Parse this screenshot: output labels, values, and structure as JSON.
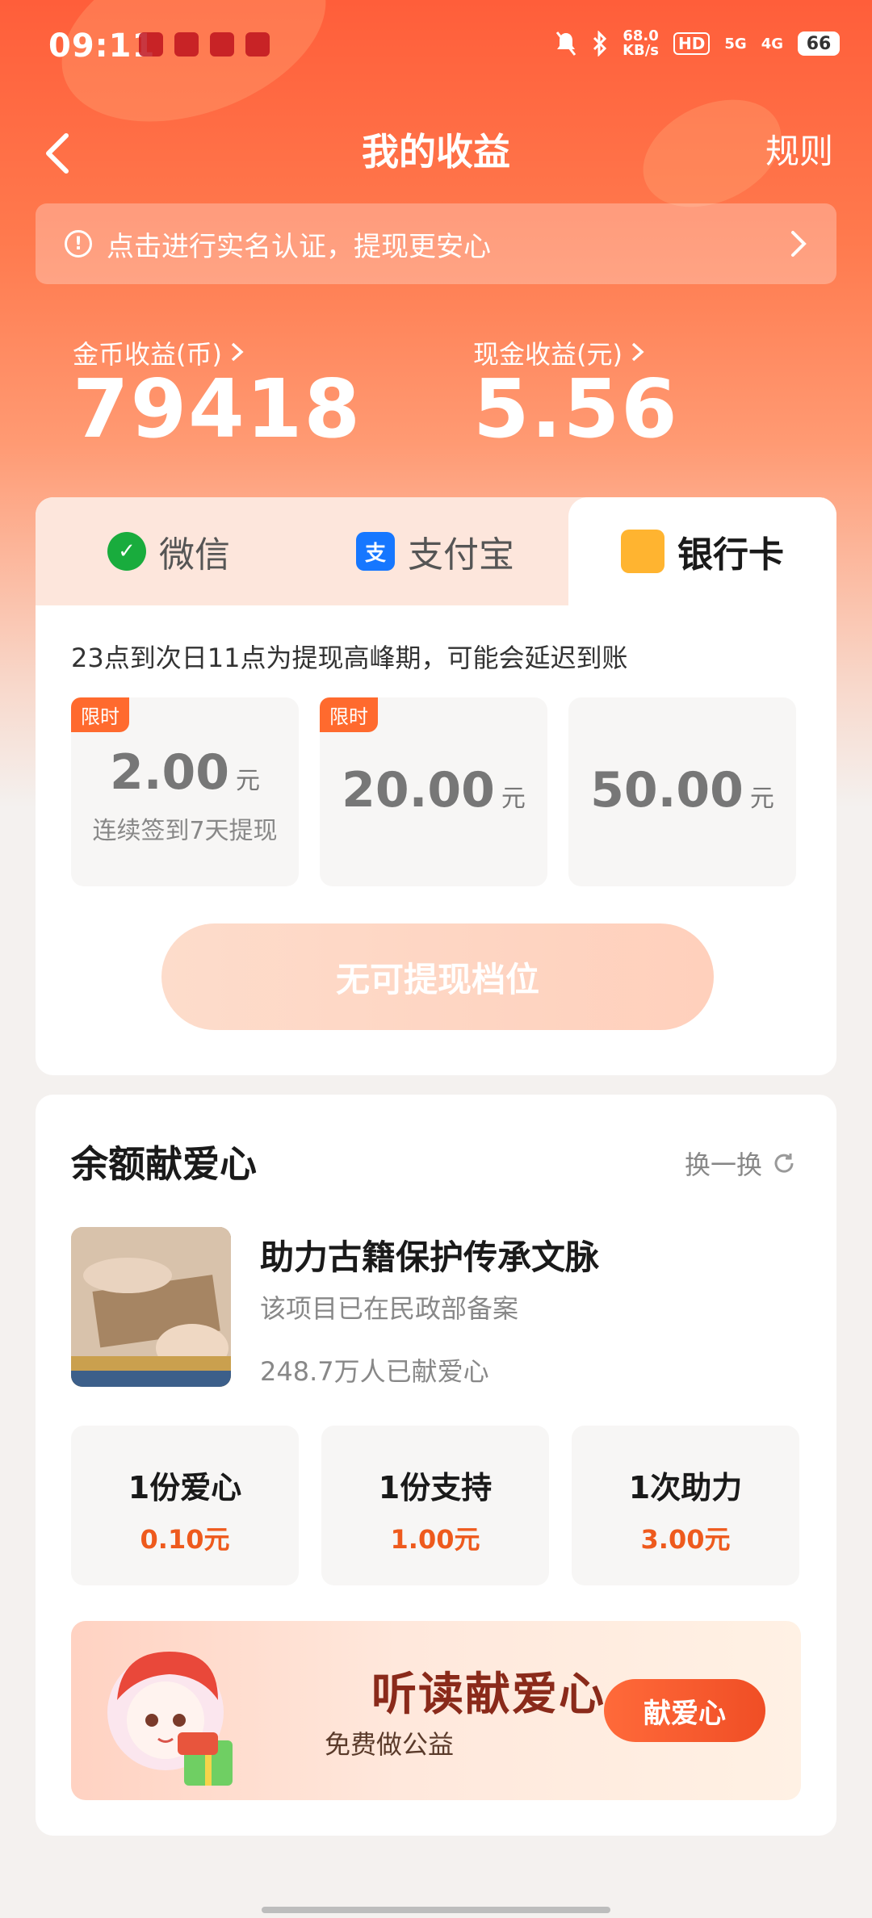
{
  "status_bar": {
    "time": "09:11",
    "net_speed_value": "68.0",
    "net_speed_unit": "KB/s",
    "hd": "HD",
    "signal_5g": "5G",
    "signal_4g": "4G",
    "battery": "66"
  },
  "nav": {
    "title": "我的收益",
    "rules": "规则"
  },
  "verify_banner": {
    "text": "点击进行实名认证，提现更安心"
  },
  "earnings": {
    "coin_label": "金币收益(币)",
    "coin_value": "79418",
    "cash_label": "现金收益(元)",
    "cash_value": "5.56"
  },
  "withdraw": {
    "tabs": [
      {
        "label": "微信"
      },
      {
        "label": "支付宝"
      },
      {
        "label": "银行卡",
        "active": true
      }
    ],
    "peak_note": "23点到次日11点为提现高峰期，可能会延迟到账",
    "options": [
      {
        "tag": "限时",
        "amount": "2.00",
        "unit": "元",
        "sub": "连续签到7天提现"
      },
      {
        "tag": "限时",
        "amount": "20.00",
        "unit": "元"
      },
      {
        "amount": "50.00",
        "unit": "元"
      }
    ],
    "button": "无可提现档位"
  },
  "donation": {
    "title": "余额献爱心",
    "refresh": "换一换",
    "project": {
      "name": "助力古籍保护传承文脉",
      "note": "该项目已在民政部备案",
      "count": "248.7万人已献爱心"
    },
    "options": [
      {
        "label": "1份爱心",
        "price": "0.10元"
      },
      {
        "label": "1份支持",
        "price": "1.00元"
      },
      {
        "label": "1次助力",
        "price": "3.00元"
      }
    ],
    "promo": {
      "title": "听读献爱心",
      "sub": "免费做公益",
      "button": "献爱心"
    }
  },
  "colors": {
    "accent": "#ff5e3a",
    "price": "#ee5a1d",
    "wechat": "#19ac3d",
    "alipay": "#1677ff",
    "bank": "#ffb430"
  }
}
